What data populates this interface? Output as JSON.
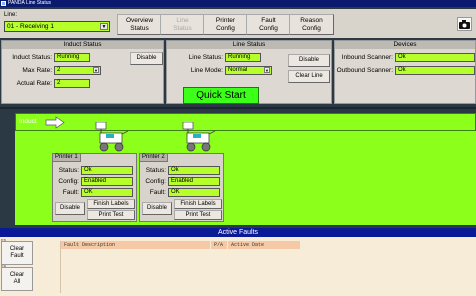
{
  "window": {
    "title": "PANDA Line Status"
  },
  "toolbar": {
    "line_label": "Line:",
    "line_value": "01 - Receiving 1",
    "buttons": [
      {
        "line1": "Overview",
        "line2": "Status"
      },
      {
        "line1": "Line",
        "line2": "Status"
      },
      {
        "line1": "Printer",
        "line2": "Config"
      },
      {
        "line1": "Fault",
        "line2": "Config"
      },
      {
        "line1": "Reason",
        "line2": "Config"
      }
    ]
  },
  "induct_status": {
    "title": "Induct Status",
    "status_label": "Induct Status:",
    "status_value": "Running",
    "max_rate_label": "Max Rate:",
    "max_rate_value": "2",
    "actual_rate_label": "Actual Rate:",
    "actual_rate_value": "2",
    "disable_label": "Disable"
  },
  "line_status": {
    "title": "Line Status",
    "status_label": "Line Status:",
    "status_value": "Running",
    "mode_label": "Line Mode:",
    "mode_value": "Normal",
    "disable_label": "Disable",
    "clear_label": "Clear Line",
    "quick_start_label": "Quick Start"
  },
  "devices": {
    "title": "Devices",
    "inbound_label": "Inbound Scanner:",
    "inbound_value": "Ok",
    "outbound_label": "Outbound Scanner:",
    "outbound_value": "Ok"
  },
  "induct_bar": {
    "label": "Induct"
  },
  "printers": [
    {
      "title": "Printer 1",
      "status_label": "Status:",
      "status": "Ok",
      "config_label": "Config:",
      "config": "Enabled",
      "fault_label": "Fault:",
      "fault": "OK",
      "disable_label": "Disable",
      "finish_label": "Finish Labels",
      "test_label": "Print Test"
    },
    {
      "title": "Printer 2",
      "status_label": "Status:",
      "status": "Ok",
      "config_label": "Config:",
      "config": "Enabled",
      "fault_label": "Fault:",
      "fault": "OK",
      "disable_label": "Disable",
      "finish_label": "Finish Labels",
      "test_label": "Print Test"
    }
  ],
  "faults": {
    "title": "Active Faults",
    "clear_fault": {
      "key": "F5",
      "line1": "Clear",
      "line2": "Fault"
    },
    "clear_all": {
      "key": "F6",
      "line1": "Clear",
      "line2": "All"
    },
    "columns": [
      "Fault Description",
      "P/A",
      "Active Date"
    ]
  },
  "colors": {
    "status_green": "#b7ff2a",
    "line_green": "#8cff1a",
    "header_blue": "#0a1a96",
    "quick_start": "#3cff1a"
  }
}
